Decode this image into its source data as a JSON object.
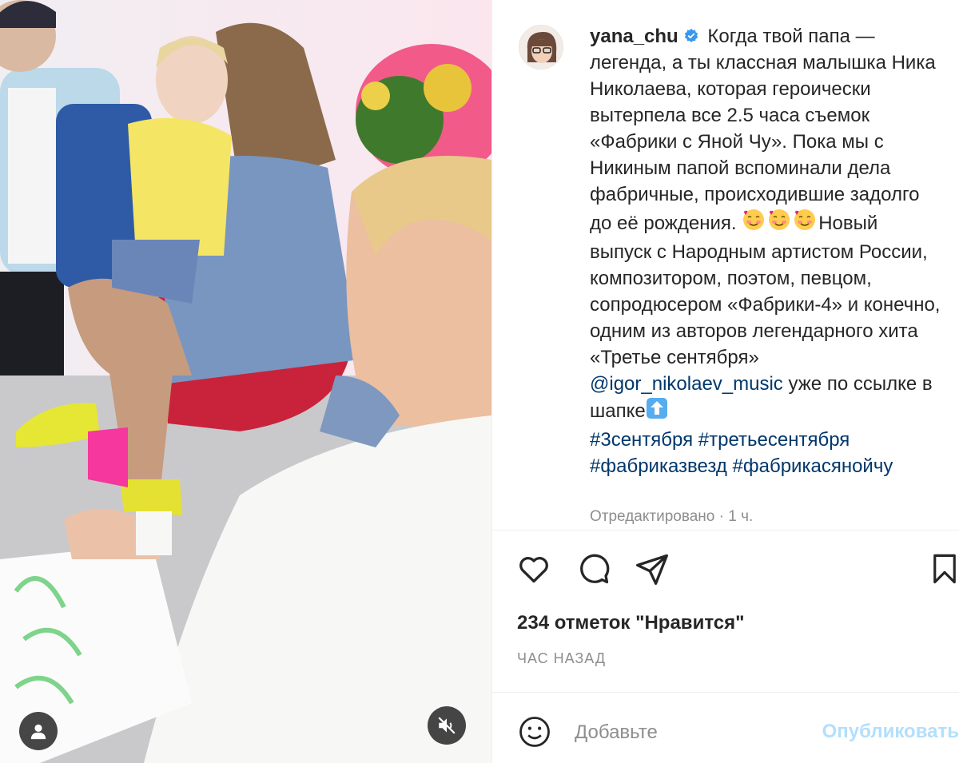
{
  "post": {
    "username": "yana_chu",
    "caption_segments": [
      {
        "text": "Когда твой папа — легенда, а ты классная малышка Ника Николаева, которая героически вытерпела все 2.5 часа съемок «Фабрики с Яной Чу». Пока мы с Никиным папой вспоминали дела фабричные, происходившие задолго до её рождения. "
      },
      {
        "text": "Новый выпуск с Народным артистом России, композитором, поэтом, певцом, сопродюсером «Фабрики-4» и конечно, одним из авторов легендарного хита «Третье сентября» "
      },
      {
        "text": "@igor_nikolaev_music"
      },
      {
        "text": " уже по ссылке в шапке"
      },
      {
        "text": "#3сентября"
      },
      {
        "text": "#третьесентября"
      },
      {
        "text": "#фабриказвезд"
      },
      {
        "text": "#фабрикасянойчу"
      }
    ],
    "edited": "Отредактировано · 1 ч.",
    "likes": "234 отметок \"Нравится\"",
    "time": "ЧАС НАЗАД"
  },
  "comment_box": {
    "placeholder": "Добавьте",
    "publish_label": "Опубликовать"
  },
  "icons": {
    "verified": "verified-badge-icon",
    "like": "heart-icon",
    "comment": "speech-bubble-icon",
    "share": "paper-plane-icon",
    "save": "bookmark-icon",
    "emoji": "smiley-icon",
    "tag": "user-tag-icon",
    "mute": "speaker-muted-icon"
  },
  "colors": {
    "link": "#00376b",
    "publish_disabled": "#b2dffc",
    "secondary_text": "#8e8e8e",
    "verified": "#3897f0"
  }
}
